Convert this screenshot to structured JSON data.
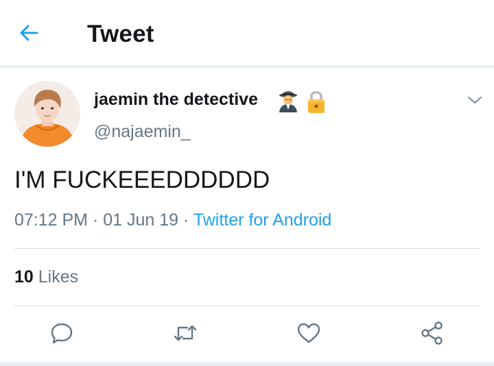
{
  "header": {
    "title": "Tweet",
    "back_icon": "arrow-left-icon"
  },
  "author": {
    "display_name": "jaemin the detective",
    "badges": [
      "detective-emoji-icon",
      "lock-icon"
    ],
    "handle": "@najaemin_"
  },
  "tweet": {
    "text": "I'M FUCKEEEDDDDDD",
    "time": "07:12 PM",
    "separator": " · ",
    "date": "01 Jun 19",
    "source": "Twitter for Android"
  },
  "stats": {
    "likes_count": "10",
    "likes_label": "Likes"
  },
  "actions": [
    "reply-icon",
    "retweet-icon",
    "like-icon",
    "share-icon"
  ],
  "colors": {
    "accent": "#1da1f2",
    "secondary_text": "#657786",
    "primary_text": "#14171a",
    "divider": "#e1e8ed"
  }
}
